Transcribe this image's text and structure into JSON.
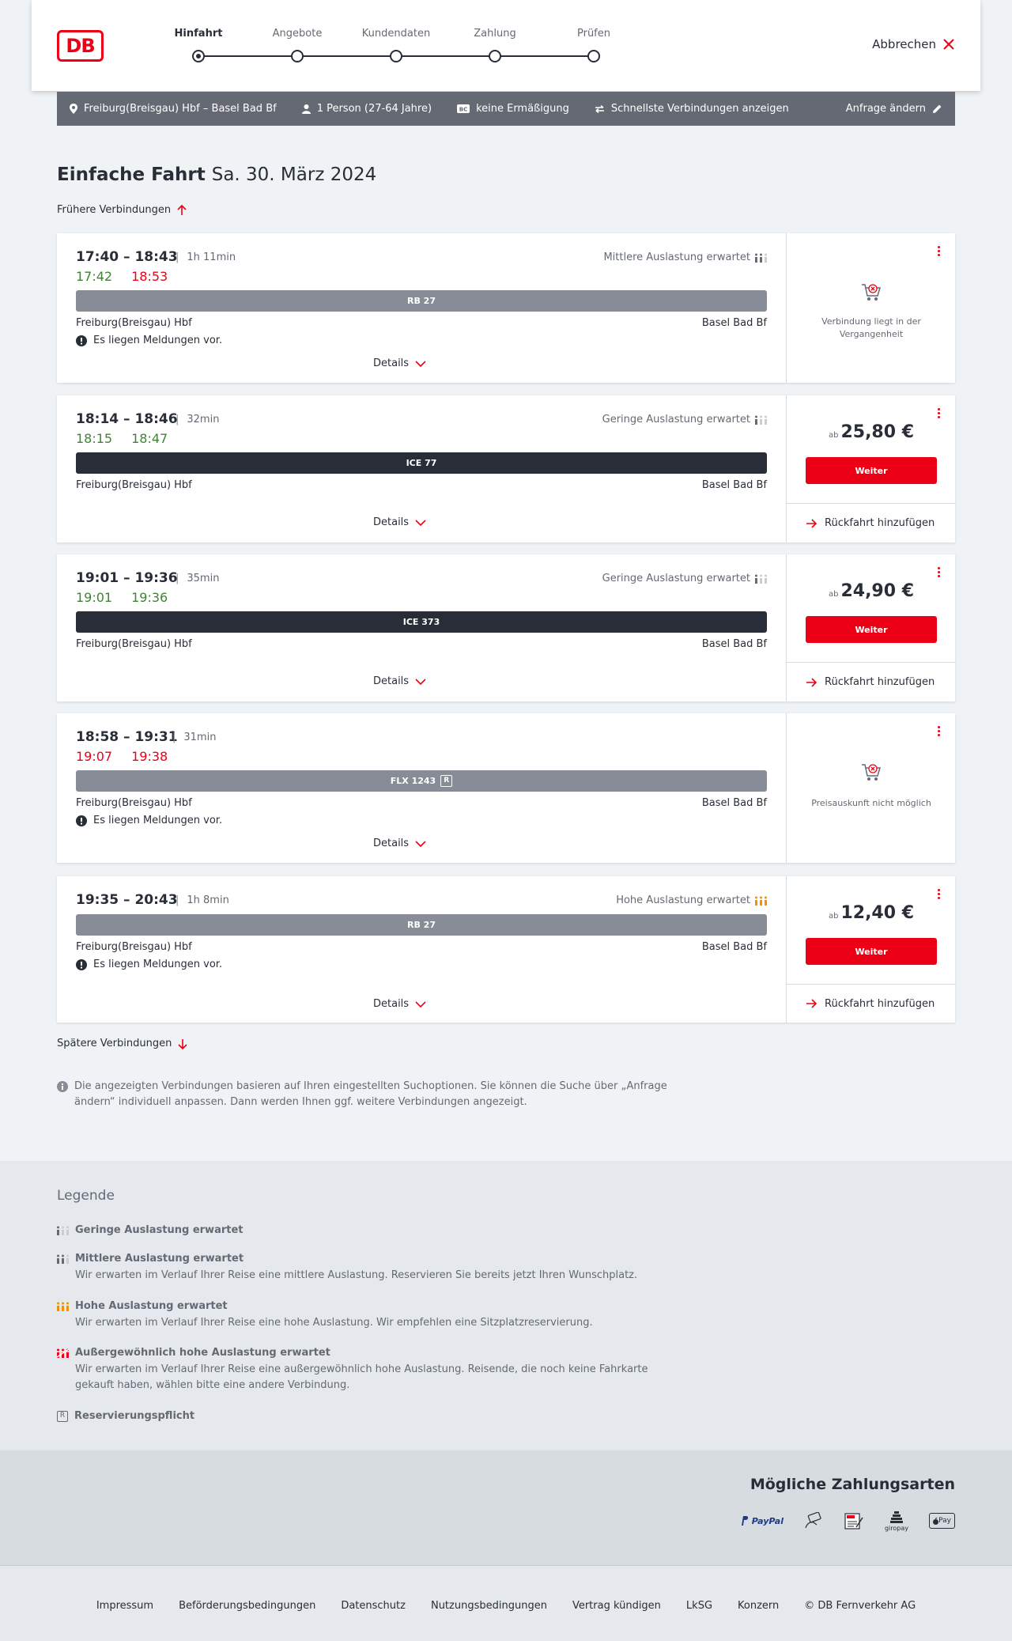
{
  "header": {
    "logo": "DB",
    "steps": [
      "Hinfahrt",
      "Angebote",
      "Kundendaten",
      "Zahlung",
      "Prüfen"
    ],
    "cancel": "Abbrechen"
  },
  "query": {
    "route": "Freiburg(Breisgau) Hbf – Basel Bad Bf",
    "persons": "1 Person (27-64 Jahre)",
    "discount": "keine Ermäßigung",
    "fastest": "Schnellste Verbindungen anzeigen",
    "change": "Anfrage ändern"
  },
  "page": {
    "title": "Einfache Fahrt",
    "date": "Sa. 30. März 2024",
    "earlier": "Frühere Verbindungen",
    "later": "Spätere Verbindungen",
    "info": "Die angezeigten Verbindungen basieren auf Ihren eingestellten Suchoptionen. Sie können die Suche über „Anfrage ändern“ individuell anpassen. Dann werden Ihnen ggf. weitere Verbindungen angezeigt."
  },
  "connections": [
    {
      "times": "17:40 – 18:43",
      "duration": "1h 11min",
      "load": "Mittlere Auslastung erwartet",
      "rt_dep": "17:42",
      "rt_arr": "18:53",
      "train": "RB 27",
      "from": "Freiburg(Breisgau) Hbf",
      "to": "Basel Bad Bf",
      "message": "Es liegen Meldungen vor.",
      "details": "Details",
      "unavailable": "Verbindung liegt in der Vergangenheit"
    },
    {
      "times": "18:14 – 18:46",
      "duration": "32min",
      "load": "Geringe Auslastung erwartet",
      "rt_dep": "18:15",
      "rt_arr": "18:47",
      "train": "ICE 77",
      "from": "Freiburg(Breisgau) Hbf",
      "to": "Basel Bad Bf",
      "details": "Details",
      "price_prefix": "ab",
      "price": "25,80 €",
      "button": "Weiter",
      "return": "Rückfahrt hinzufügen"
    },
    {
      "times": "19:01 – 19:36",
      "duration": "35min",
      "load": "Geringe Auslastung erwartet",
      "rt_dep": "19:01",
      "rt_arr": "19:36",
      "train": "ICE 373",
      "from": "Freiburg(Breisgau) Hbf",
      "to": "Basel Bad Bf",
      "details": "Details",
      "price_prefix": "ab",
      "price": "24,90 €",
      "button": "Weiter",
      "return": "Rückfahrt hinzufügen"
    },
    {
      "times": "18:58 – 19:31",
      "duration": "31min",
      "rt_dep": "19:07",
      "rt_arr": "19:38",
      "train": "FLX 1243",
      "reservation": "R",
      "from": "Freiburg(Breisgau) Hbf",
      "to": "Basel Bad Bf",
      "message": "Es liegen Meldungen vor.",
      "details": "Details",
      "unavailable": "Preisauskunft nicht möglich"
    },
    {
      "times": "19:35 – 20:43",
      "duration": "1h 8min",
      "load": "Hohe Auslastung erwartet",
      "train": "RB 27",
      "from": "Freiburg(Breisgau) Hbf",
      "to": "Basel Bad Bf",
      "message": "Es liegen Meldungen vor.",
      "details": "Details",
      "price_prefix": "ab",
      "price": "12,40 €",
      "button": "Weiter",
      "return": "Rückfahrt hinzufügen"
    }
  ],
  "legend": {
    "title": "Legende",
    "items": [
      {
        "title": "Geringe Auslastung erwartet",
        "icon": "load-low-icon"
      },
      {
        "title": "Mittlere Auslastung erwartet",
        "text": "Wir erwarten im Verlauf Ihrer Reise eine mittlere Auslastung. Reservieren Sie bereits jetzt Ihren Wunschplatz.",
        "icon": "load-medium-icon"
      },
      {
        "title": "Hohe Auslastung erwartet",
        "text": "Wir erwarten im Verlauf Ihrer Reise eine hohe Auslastung. Wir empfehlen eine Sitzplatzreservierung.",
        "icon": "load-high-icon"
      },
      {
        "title": "Außergewöhnlich hohe Auslastung erwartet",
        "text": "Wir erwarten im Verlauf Ihrer Reise eine außergewöhnlich hohe Auslastung. Reisende, die noch keine Fahrkarte gekauft haben, wählen bitte eine andere Verbindung.",
        "icon": "load-extreme-icon"
      },
      {
        "title": "Reservierungspflicht",
        "icon": "reservation-icon",
        "symbol": "R"
      }
    ]
  },
  "payment": {
    "title": "Mögliche Zahlungsarten",
    "paypal": "PayPal",
    "giropay": "giropay",
    "sepa": "SEPA",
    "applepay": "Pay"
  },
  "footer": {
    "links": [
      "Impressum",
      "Beförderungsbedingungen",
      "Datenschutz",
      "Nutzungsbedingungen",
      "Vertrag kündigen",
      "LkSG",
      "Konzern",
      "© DB Fernverkehr AG"
    ]
  },
  "colors": {
    "brand": "#ec0016",
    "delay": "#ec0016",
    "ontime": "#408335",
    "dark": "#282d37",
    "grey": "#646973",
    "high_load": "#f39200"
  }
}
